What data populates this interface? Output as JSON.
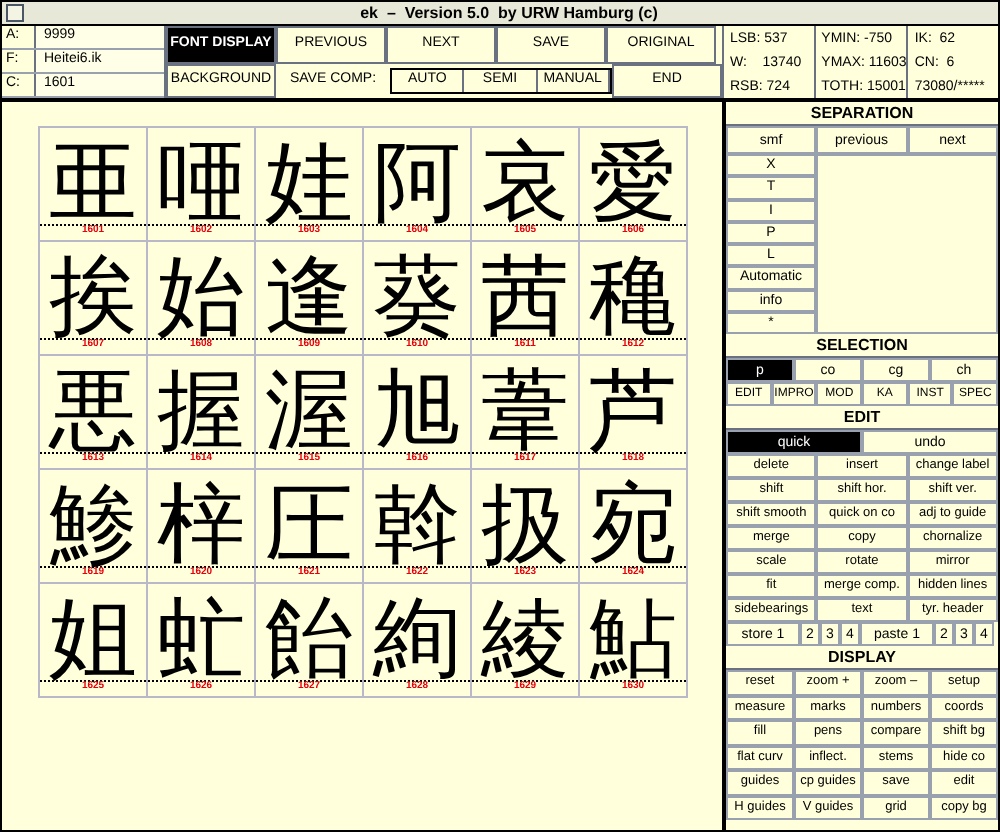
{
  "window": {
    "title": "ek  –  Version 5.0  by URW Hamburg (c)"
  },
  "fields": [
    {
      "label": "A:",
      "value": "9999"
    },
    {
      "label": "F:",
      "value": "Heitei6.ik"
    },
    {
      "label": "C:",
      "value": "1601"
    }
  ],
  "top_buttons": [
    {
      "label": "FONT DISPLAY",
      "selected": true
    },
    {
      "label": "PREVIOUS",
      "selected": false
    },
    {
      "label": "NEXT",
      "selected": false
    },
    {
      "label": "SAVE",
      "selected": false
    },
    {
      "label": "ORIGINAL",
      "selected": false
    }
  ],
  "background_button": "BACKGROUND",
  "save_comp": {
    "label": "SAVE COMP:",
    "options": [
      "AUTO",
      "SEMI",
      "MANUAL"
    ]
  },
  "end_button": "END",
  "stats": [
    [
      "LSB: 537",
      "W:    13740",
      "RSB: 724"
    ],
    [
      "YMIN: -750",
      "YMAX: 11603",
      "TOTH: 15001"
    ],
    [
      "IK:  62",
      "CN:  6",
      "73080/*****"
    ]
  ],
  "glyphs": [
    {
      "char": "亜",
      "code": "1601"
    },
    {
      "char": "唖",
      "code": "1602"
    },
    {
      "char": "娃",
      "code": "1603"
    },
    {
      "char": "阿",
      "code": "1604"
    },
    {
      "char": "哀",
      "code": "1605"
    },
    {
      "char": "愛",
      "code": "1606"
    },
    {
      "char": "挨",
      "code": "1607"
    },
    {
      "char": "始",
      "code": "1608"
    },
    {
      "char": "逢",
      "code": "1609"
    },
    {
      "char": "葵",
      "code": "1610"
    },
    {
      "char": "茜",
      "code": "1611"
    },
    {
      "char": "穐",
      "code": "1612"
    },
    {
      "char": "悪",
      "code": "1613"
    },
    {
      "char": "握",
      "code": "1614"
    },
    {
      "char": "渥",
      "code": "1615"
    },
    {
      "char": "旭",
      "code": "1616"
    },
    {
      "char": "葦",
      "code": "1617"
    },
    {
      "char": "芦",
      "code": "1618"
    },
    {
      "char": "鯵",
      "code": "1619"
    },
    {
      "char": "梓",
      "code": "1620"
    },
    {
      "char": "圧",
      "code": "1621"
    },
    {
      "char": "斡",
      "code": "1622"
    },
    {
      "char": "扱",
      "code": "1623"
    },
    {
      "char": "宛",
      "code": "1624"
    },
    {
      "char": "姐",
      "code": "1625"
    },
    {
      "char": "虻",
      "code": "1626"
    },
    {
      "char": "飴",
      "code": "1627"
    },
    {
      "char": "絢",
      "code": "1628"
    },
    {
      "char": "綾",
      "code": "1629"
    },
    {
      "char": "鮎",
      "code": "1630"
    }
  ],
  "separation": {
    "title": "SEPARATION",
    "nav": [
      "smf",
      "previous",
      "next"
    ],
    "items": [
      "X",
      "T",
      "I",
      "P",
      "L",
      "Automatic",
      "info",
      "*"
    ]
  },
  "selection": {
    "title": "SELECTION",
    "tabs": [
      {
        "label": "p",
        "selected": true
      },
      {
        "label": "co",
        "selected": false
      },
      {
        "label": "cg",
        "selected": false
      },
      {
        "label": "ch",
        "selected": false
      }
    ],
    "modes": [
      "EDIT",
      "IMPRO",
      "MOD",
      "KA",
      "INST",
      "SPEC"
    ]
  },
  "edit": {
    "title": "EDIT",
    "tabs": [
      {
        "label": "quick",
        "selected": true
      },
      {
        "label": "undo",
        "selected": false
      }
    ],
    "buttons": [
      "delete",
      "insert",
      "change label",
      "shift",
      "shift hor.",
      "shift ver.",
      "shift smooth",
      "quick on co",
      "adj to guide",
      "merge",
      "copy",
      "chornalize",
      "scale",
      "rotate",
      "mirror",
      "fit",
      "merge comp.",
      "hidden lines",
      "sidebearings",
      "text",
      "tyr. header"
    ],
    "store": [
      "store 1",
      "2",
      "3",
      "4"
    ],
    "paste": [
      "paste 1",
      "2",
      "3",
      "4"
    ]
  },
  "display": {
    "title": "DISPLAY",
    "buttons": [
      "reset",
      "zoom +",
      "zoom –",
      "setup",
      "measure",
      "marks",
      "numbers",
      "coords",
      "fill",
      "pens",
      "compare",
      "shift bg",
      "flat curv",
      "inflect.",
      "stems",
      "hide co",
      "guides",
      "cp guides",
      "save",
      "edit",
      "H guides",
      "V guides",
      "grid",
      "copy bg"
    ]
  }
}
